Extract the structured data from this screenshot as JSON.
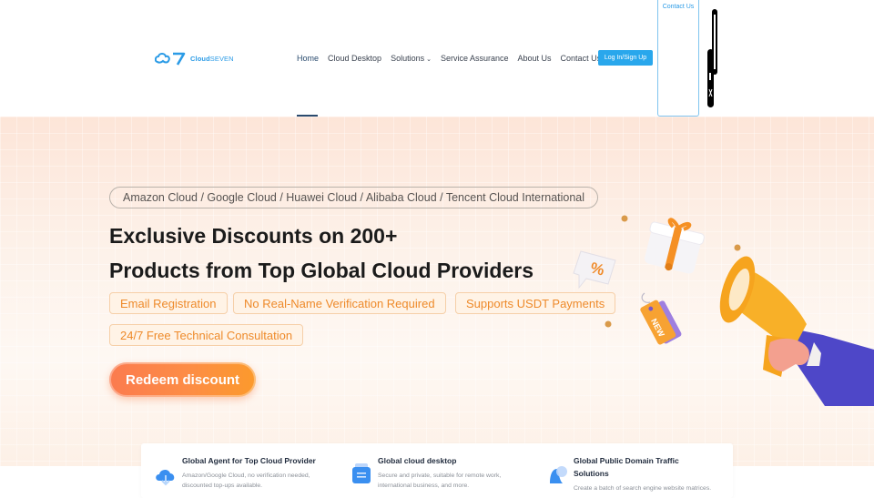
{
  "header": {
    "logo": {
      "mark": "C7",
      "brand_bold": "Cloud",
      "brand_rest": "SEVEN"
    },
    "nav": [
      {
        "label": "Home",
        "active": true
      },
      {
        "label": "Cloud Desktop"
      },
      {
        "label": "Solutions",
        "has_dropdown": true,
        "chevron": "⌄"
      },
      {
        "label": "Service Assurance"
      },
      {
        "label": "About Us"
      },
      {
        "label": "Contact Us"
      }
    ],
    "login_label": "Log In/Sign Up",
    "contact_panel_label": "Contact Us"
  },
  "hero": {
    "providers": "Amazon Cloud / Google Cloud / Huawei Cloud / Alibaba Cloud / Tencent Cloud International",
    "title_line1": "Exclusive Discounts on 200+",
    "title_line2": "Products from Top Global Cloud Providers",
    "tags": [
      "Email Registration",
      "No Real-Name Verification Required",
      "Supports USDT Payments",
      "24/7 Free Technical Consultation"
    ],
    "cta_label": "Redeem discount",
    "illustration": {
      "percent_glyph": "%",
      "tag_text": "NEW"
    }
  },
  "features": [
    {
      "icon": "cloud-download-icon",
      "title": "Global Agent for Top Cloud Provider",
      "desc_line1": "Amazon/Google Cloud, no verification needed,",
      "desc_line2": "discounted top-ups available."
    },
    {
      "icon": "desktop-document-icon",
      "title": "Global cloud desktop",
      "desc_line1": "Secure and private, suitable for remote work,",
      "desc_line2": "international business, and more."
    },
    {
      "icon": "bell-traffic-icon",
      "title_line1": "Global Public Domain Traffic",
      "title_line2": "Solutions",
      "desc_line1": "Create a batch of search engine website matrices."
    }
  ],
  "colors": {
    "brand_blue": "#29a7ec",
    "nav_active": "#2a4b6e",
    "tag_orange": "#ee8a2a",
    "cta_start": "#fb7b4f",
    "cta_end": "#fc9a2c"
  }
}
